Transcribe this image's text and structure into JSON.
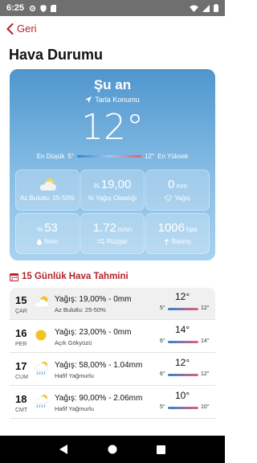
{
  "status_bar": {
    "time": "6:25"
  },
  "nav": {
    "back_label": "Geri"
  },
  "page_title": "Hava Durumu",
  "current": {
    "heading": "Şu an",
    "location": "Tarla Konumu",
    "temperature": "12°",
    "min_label": "En Düşük",
    "min_value": "5°",
    "max_value": "12°",
    "max_label": "En Yüksek"
  },
  "tiles": [
    {
      "value": "",
      "unit": "",
      "label": "Az Bulutlu: 25-50%",
      "icon": "partly-cloudy-icon"
    },
    {
      "prefix": "%",
      "value": "19,00",
      "unit": "",
      "label": "% Yağış Olasılığı"
    },
    {
      "value": "0",
      "unit": "mm",
      "label": "Yağış",
      "icon": "rain-icon"
    },
    {
      "prefix": "%",
      "value": "53",
      "unit": "",
      "label": "Nem",
      "icon": "droplet-icon"
    },
    {
      "value": "1.72",
      "unit": "m/sn",
      "label": "Rüzgar",
      "icon": "wind-icon"
    },
    {
      "value": "1006",
      "unit": "hpa",
      "label": "Basınç",
      "icon": "arrow-up-icon"
    }
  ],
  "forecast": {
    "title": "15 Günlük Hava Tahmini",
    "days": [
      {
        "day": "15",
        "weekday": "ÇAR",
        "rain": "Yağış: 19,00% - 0mm",
        "desc": "Az Bulutlu: 25-50%",
        "temp": "12°",
        "min": "5°",
        "max": "12°",
        "icon": "partly-cloudy-icon"
      },
      {
        "day": "16",
        "weekday": "PER",
        "rain": "Yağış: 23,00% - 0mm",
        "desc": "Açık Gökyüzü",
        "temp": "14°",
        "min": "6°",
        "max": "14°",
        "icon": "sun-icon"
      },
      {
        "day": "17",
        "weekday": "CUM",
        "rain": "Yağış: 58,00% - 1.04mm",
        "desc": "Hafif Yağmurlu",
        "temp": "12°",
        "min": "6°",
        "max": "12°",
        "icon": "light-rain-icon"
      },
      {
        "day": "18",
        "weekday": "CMT",
        "rain": "Yağış: 90,00% - 2.06mm",
        "desc": "Hafif Yağmurlu",
        "temp": "10°",
        "min": "5°",
        "max": "10°",
        "icon": "light-rain-icon"
      }
    ]
  },
  "colors": {
    "accent": "#b4232a",
    "card_top": "#4f96cd",
    "card_bottom": "#a8d2ef"
  }
}
